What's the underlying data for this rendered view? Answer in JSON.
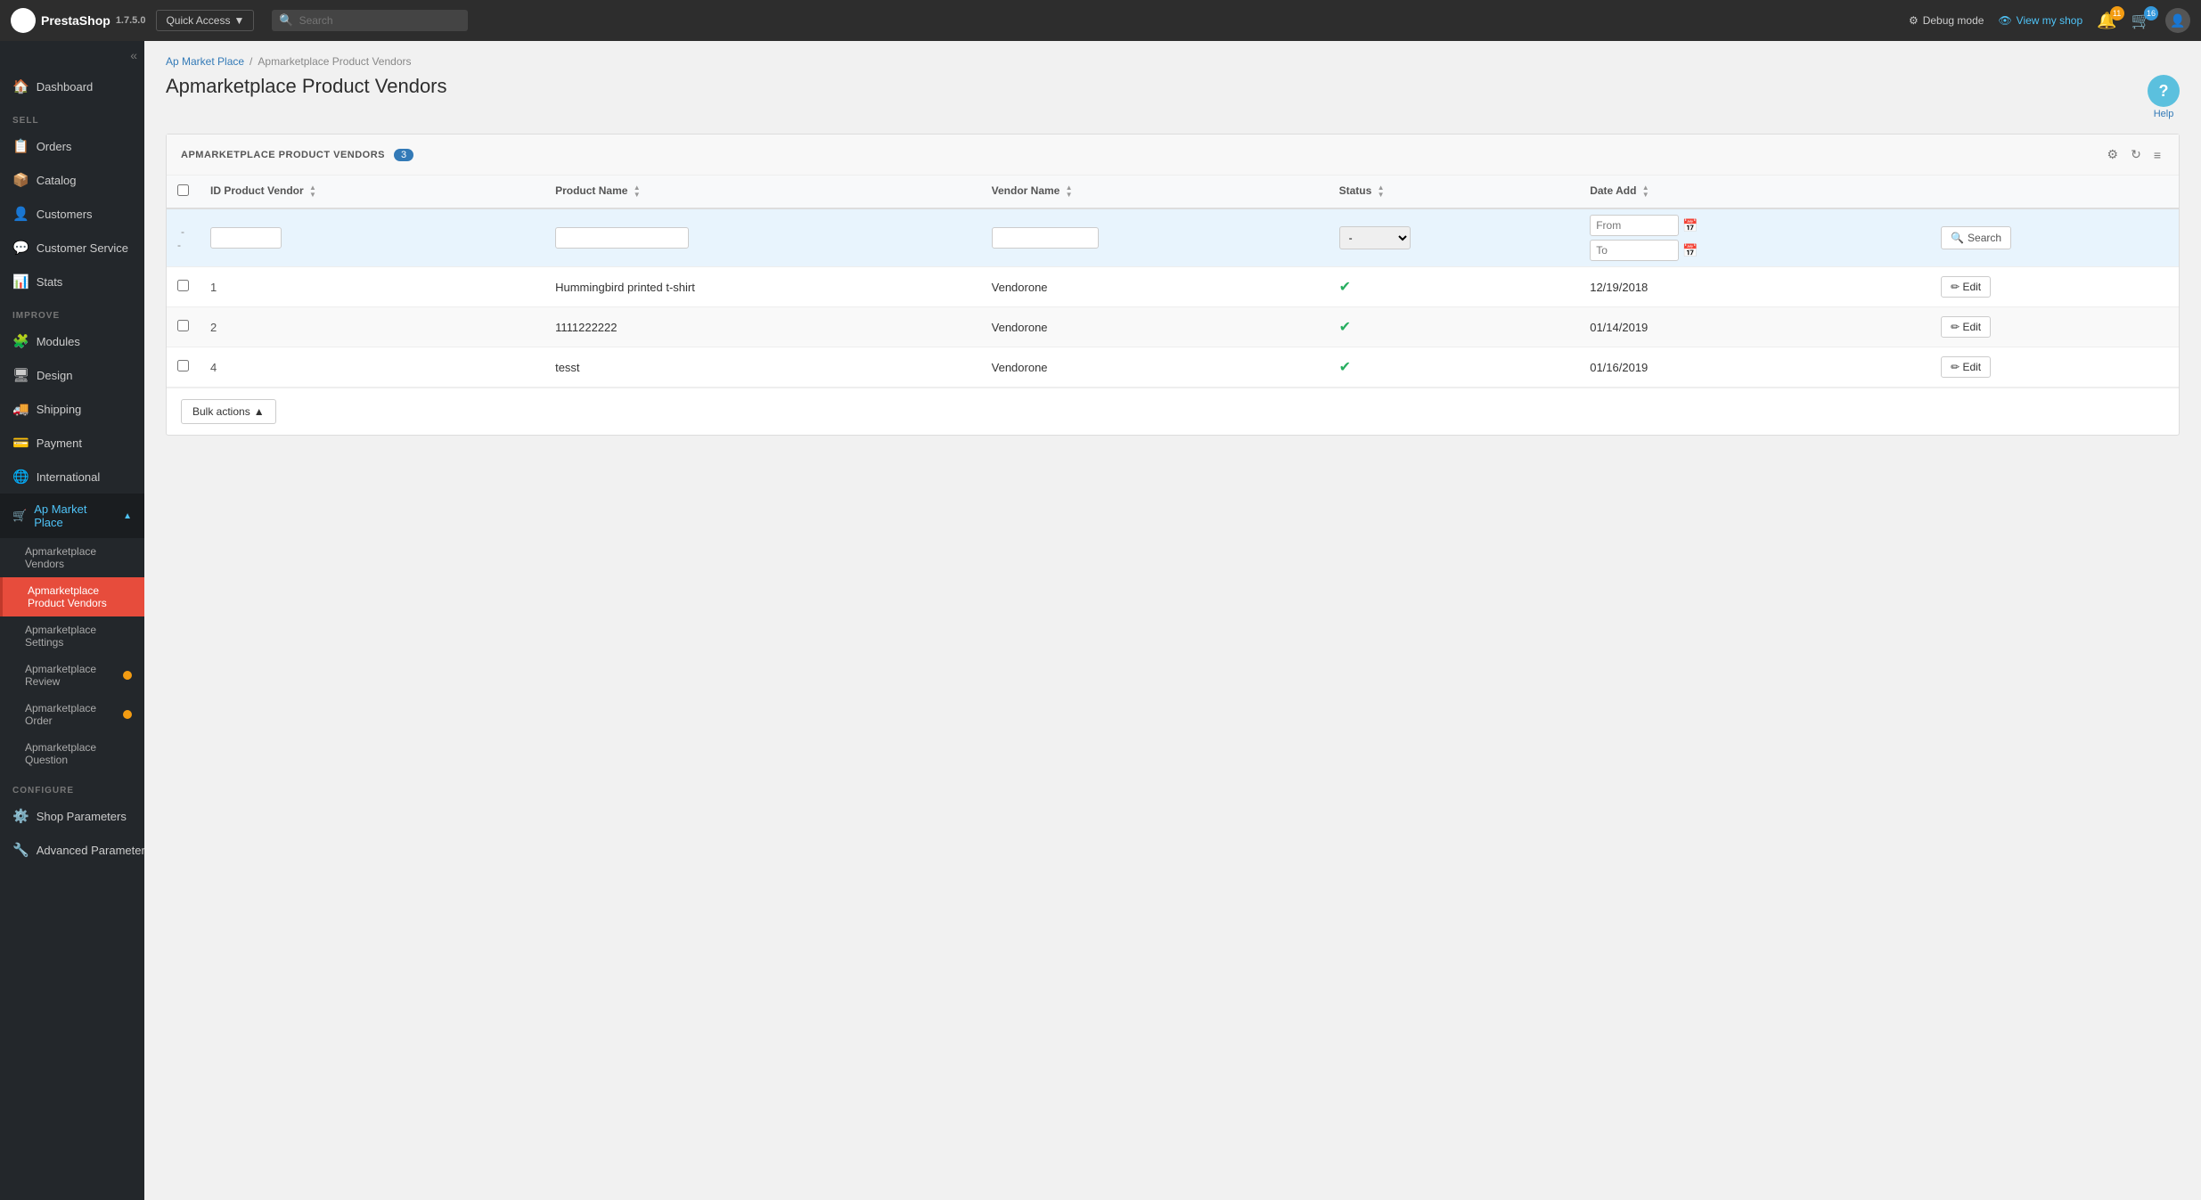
{
  "app": {
    "name": "PrestaShop",
    "version": "1.7.5.0"
  },
  "topbar": {
    "quick_access_label": "Quick Access",
    "search_placeholder": "Search",
    "debug_mode_label": "Debug mode",
    "view_shop_label": "View my shop",
    "notifications_count": "11",
    "cart_count": "16"
  },
  "sidebar": {
    "collapse_icon": "«",
    "sections": [
      {
        "label": "",
        "items": [
          {
            "id": "dashboard",
            "label": "Dashboard",
            "icon": "🏠",
            "active": false
          }
        ]
      },
      {
        "label": "SELL",
        "items": [
          {
            "id": "orders",
            "label": "Orders",
            "icon": "📋",
            "active": false
          },
          {
            "id": "catalog",
            "label": "Catalog",
            "icon": "📦",
            "active": false
          },
          {
            "id": "customers",
            "label": "Customers",
            "icon": "👤",
            "active": false
          },
          {
            "id": "customer-service",
            "label": "Customer Service",
            "icon": "💬",
            "active": false
          },
          {
            "id": "stats",
            "label": "Stats",
            "icon": "📊",
            "active": false
          }
        ]
      },
      {
        "label": "IMPROVE",
        "items": [
          {
            "id": "modules",
            "label": "Modules",
            "icon": "🧩",
            "active": false
          },
          {
            "id": "design",
            "label": "Design",
            "icon": "🖥",
            "active": false
          },
          {
            "id": "shipping",
            "label": "Shipping",
            "icon": "🚚",
            "active": false
          },
          {
            "id": "payment",
            "label": "Payment",
            "icon": "💳",
            "active": false
          },
          {
            "id": "international",
            "label": "International",
            "icon": "🌐",
            "active": false
          }
        ]
      },
      {
        "label": "CONFIGURE",
        "items": [
          {
            "id": "shop-parameters",
            "label": "Shop Parameters",
            "icon": "⚙️",
            "active": false
          },
          {
            "id": "advanced-parameters",
            "label": "Advanced Parameters",
            "icon": "🔧",
            "active": false
          }
        ]
      }
    ],
    "ap_marketplace": {
      "label": "Ap Market Place",
      "icon": "🛒",
      "active": true,
      "sub_items": [
        {
          "id": "apmarketplace-vendors",
          "label": "Apmarketplace Vendors",
          "active": false
        },
        {
          "id": "apmarketplace-product-vendors",
          "label": "Apmarketplace Product Vendors",
          "active": true
        },
        {
          "id": "apmarketplace-settings",
          "label": "Apmarketplace Settings",
          "active": false
        },
        {
          "id": "apmarketplace-review",
          "label": "Apmarketplace Review",
          "active": false,
          "badge": true
        },
        {
          "id": "apmarketplace-order",
          "label": "Apmarketplace Order",
          "active": false,
          "badge": true
        },
        {
          "id": "apmarketplace-question",
          "label": "Apmarketplace Question",
          "active": false
        }
      ]
    }
  },
  "breadcrumb": {
    "items": [
      {
        "label": "Ap Market Place",
        "link": true
      },
      {
        "label": "Apmarketplace Product Vendors",
        "link": false
      }
    ]
  },
  "page": {
    "title": "Apmarketplace Product Vendors",
    "help_label": "Help"
  },
  "table": {
    "card_title": "APMARKETPLACE PRODUCT VENDORS",
    "count": "3",
    "columns": [
      {
        "id": "id",
        "label": "ID Product Vendor",
        "sortable": true
      },
      {
        "id": "product_name",
        "label": "Product Name",
        "sortable": true
      },
      {
        "id": "vendor_name",
        "label": "Vendor Name",
        "sortable": true
      },
      {
        "id": "status",
        "label": "Status",
        "sortable": true
      },
      {
        "id": "date_add",
        "label": "Date Add",
        "sortable": true
      }
    ],
    "filters": {
      "id_placeholder": "",
      "product_placeholder": "",
      "vendor_placeholder": "",
      "status_options": [
        "-"
      ],
      "from_label": "From",
      "to_label": "To",
      "search_label": "Search"
    },
    "rows": [
      {
        "id": "1",
        "product_name": "Hummingbird printed t-shirt",
        "vendor_name": "Vendorone",
        "status": true,
        "date_add": "12/19/2018",
        "edit_label": "Edit"
      },
      {
        "id": "2",
        "product_name": "1111222222",
        "vendor_name": "Vendorone",
        "status": true,
        "date_add": "01/14/2019",
        "edit_label": "Edit"
      },
      {
        "id": "4",
        "product_name": "tesst",
        "vendor_name": "Vendorone",
        "status": true,
        "date_add": "01/16/2019",
        "edit_label": "Edit"
      }
    ],
    "bulk_actions_label": "Bulk actions"
  }
}
